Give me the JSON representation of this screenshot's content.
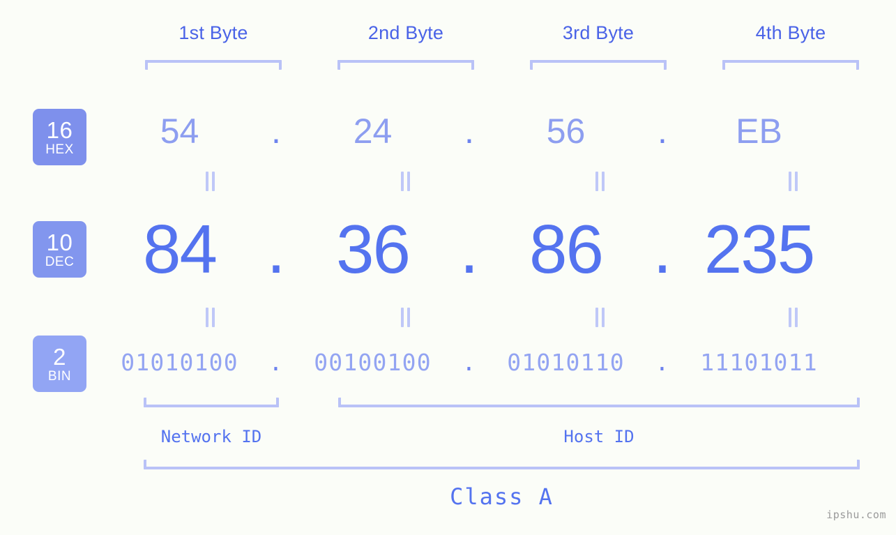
{
  "meta": {
    "background_color": "#fbfdf8",
    "accent_blue": "#4a63e7",
    "accent_light": "#b9c2f7",
    "watermark": "ipshu.com"
  },
  "byte_headers": [
    {
      "label": "1st Byte"
    },
    {
      "label": "2nd Byte"
    },
    {
      "label": "3rd Byte"
    },
    {
      "label": "4th Byte"
    }
  ],
  "bases": [
    {
      "radix": "16",
      "name": "HEX",
      "color": "#7e90ec"
    },
    {
      "radix": "10",
      "name": "DEC",
      "color": "#8296ee"
    },
    {
      "radix": "2",
      "name": "BIN",
      "color": "#92a5f4"
    }
  ],
  "rows": {
    "hex": {
      "values": [
        "54",
        "24",
        "56",
        "EB"
      ],
      "separator": "."
    },
    "dec": {
      "values": [
        "84",
        "36",
        "86",
        "235"
      ],
      "separator": "."
    },
    "bin": {
      "values": [
        "01010100",
        "00100100",
        "01010110",
        "11101011"
      ],
      "separator": "."
    }
  },
  "segments": {
    "network_id": "Network ID",
    "host_id": "Host ID",
    "class": "Class A"
  }
}
